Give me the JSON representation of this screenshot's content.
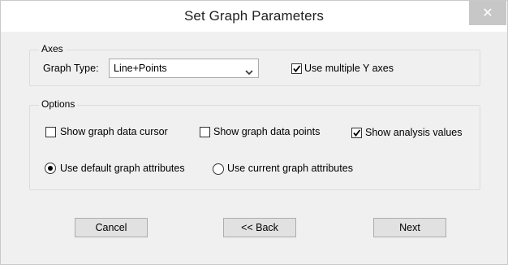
{
  "window": {
    "title": "Set Graph Parameters",
    "close_glyph": "✕"
  },
  "axes": {
    "legend": "Axes",
    "graph_type_label": "Graph Type:",
    "graph_type_value": "Line+Points",
    "multiple_y_label": "Use multiple Y axes",
    "multiple_y_checked": true
  },
  "options": {
    "legend": "Options",
    "data_cursor_label": "Show graph data cursor",
    "data_cursor_checked": false,
    "data_points_label": "Show graph data points",
    "data_points_checked": false,
    "analysis_values_label": "Show analysis values",
    "analysis_values_checked": true,
    "default_attrs_label": "Use default graph attributes",
    "default_attrs_selected": true,
    "current_attrs_label": "Use current graph attributes",
    "current_attrs_selected": false
  },
  "buttons": {
    "cancel": "Cancel",
    "back": "<< Back",
    "next": "Next"
  },
  "colors": {
    "dialog_bg": "#f0f0f0",
    "titlebar_bg": "#ffffff",
    "close_bg": "#c7c7c7",
    "button_bg": "#e1e1e1"
  }
}
